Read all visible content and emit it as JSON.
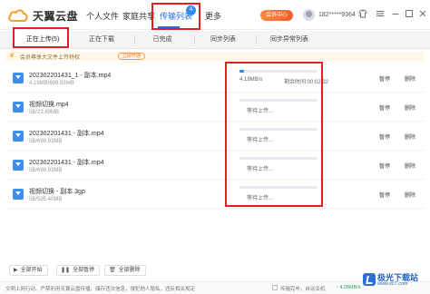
{
  "app": {
    "name": "天翼云盘"
  },
  "nav": {
    "items": [
      "个人文件",
      "家庭共享",
      "传输列表",
      "更多"
    ],
    "active_index": 2,
    "badge": "4"
  },
  "header": {
    "vip_label": "会员中心",
    "user": "182*****9364",
    "user_caret": "⌄",
    "icons": [
      "skin-icon",
      "menu-icon",
      "minimize-icon",
      "maximize-icon",
      "close-icon"
    ]
  },
  "tabs": [
    {
      "label": "正在上传(5)",
      "active": true
    },
    {
      "label": "正在下载",
      "active": false
    },
    {
      "label": "已完成",
      "active": false
    },
    {
      "label": "同步列表",
      "active": false
    },
    {
      "label": "同步异常列表",
      "active": false
    }
  ],
  "notice": {
    "text": "会员尊享大文件上传特权",
    "button": "立即开通"
  },
  "uploads": [
    {
      "name": "202302201431_1 - 副本.mp4",
      "size": "4.19MB/699.93MB",
      "progress": 0.06,
      "speed": "4.19MB/s",
      "remaining": "剩余时间:00:02:32",
      "status": "",
      "action_1": "暂停",
      "action_2": "删除"
    },
    {
      "name": "视频切换.mp4",
      "size": "0B/23.89MB",
      "progress": 0,
      "speed": "",
      "remaining": "",
      "status": "等待上传...",
      "action_1": "暂停",
      "action_2": "删除"
    },
    {
      "name": "202302201431 - 副本.mp4",
      "size": "0B/699.93MB",
      "progress": 0,
      "speed": "",
      "remaining": "",
      "status": "等待上传...",
      "action_1": "暂停",
      "action_2": "删除"
    },
    {
      "name": "202302201431 - 副本.mp4",
      "size": "0B/699.93MB",
      "progress": 0,
      "speed": "",
      "remaining": "",
      "status": "等待上传...",
      "action_1": "暂停",
      "action_2": "删除"
    },
    {
      "name": "视频切换 - 副本.3gp",
      "size": "0B/595.40MB",
      "progress": 0,
      "speed": "",
      "remaining": "",
      "status": "等待上传...",
      "action_1": "暂停",
      "action_2": "删除"
    }
  ],
  "footer": {
    "start_all": "全部开始",
    "pause_all": "全部暂停",
    "delete_all": "全部删除"
  },
  "statusbar": {
    "notice": "文明上网行动、严禁利用天翼云盘传播、储存违法信息，侵犯他人隐私，违反相关规定",
    "shutdown_label": "传输完毕，自动关机",
    "upload_speed": "↑ 4.28MB/s"
  },
  "watermark": {
    "text": "极光下载站",
    "url": "www.xz7.com"
  },
  "colors": {
    "accent": "#1f6fe8",
    "highlight": "#e02020",
    "vip": "#f35c2a"
  }
}
